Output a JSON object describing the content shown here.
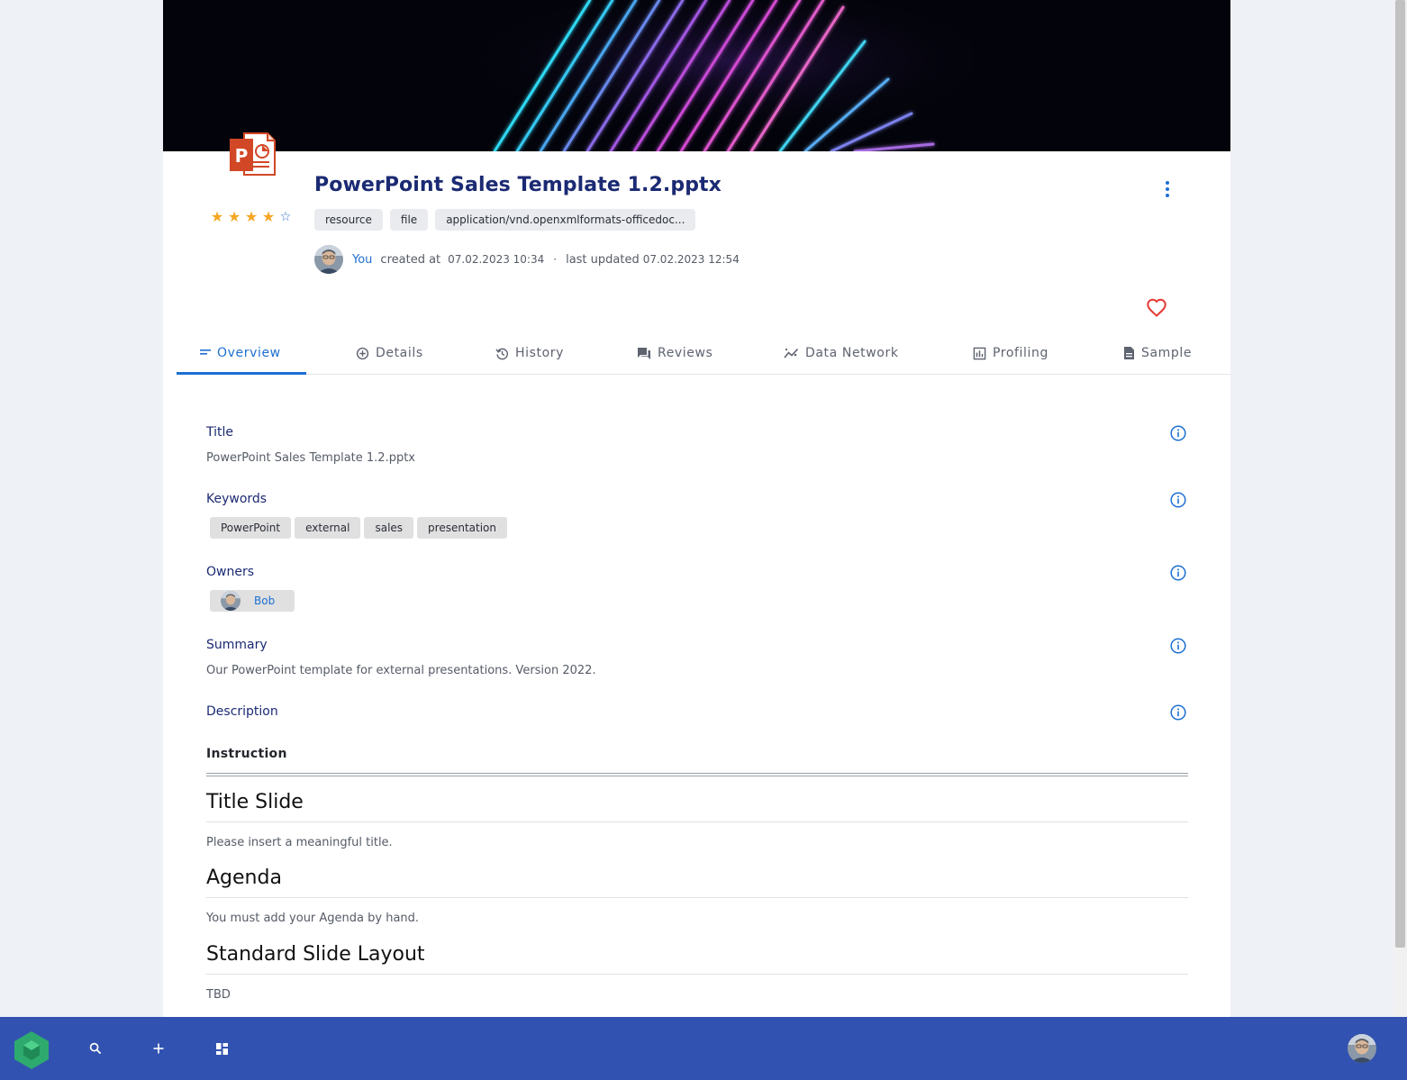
{
  "resource": {
    "title": "PowerPoint Sales Template 1.2.pptx",
    "rating": 4,
    "rating_max": 5,
    "type_tags": [
      "resource",
      "file",
      "application/vnd.openxmlformats-officedoc..."
    ],
    "icon": "powerpoint-file-icon",
    "meta": {
      "creator": "You",
      "created_label": "created at",
      "created_date": "07.02.2023 10:34",
      "separator": "·",
      "updated_label": "last updated",
      "updated_date": "07.02.2023 12:54"
    }
  },
  "tabs": {
    "overview": "Overview",
    "details": "Details",
    "history": "History",
    "reviews": "Reviews",
    "data_network": "Data Network",
    "profiling": "Profiling",
    "sample": "Sample"
  },
  "overview": {
    "title_label": "Title",
    "title_value": "PowerPoint Sales Template 1.2.pptx",
    "keywords_label": "Keywords",
    "keywords": [
      "PowerPoint",
      "external",
      "sales",
      "presentation"
    ],
    "owners_label": "Owners",
    "owners": [
      "Bob"
    ],
    "summary_label": "Summary",
    "summary_value": "Our PowerPoint template for external presentations. Version 2022.",
    "description_label": "Description"
  },
  "description_doc": {
    "heading": "Instruction",
    "sections": [
      {
        "title": "Title Slide",
        "text": "Please insert a meaningful title."
      },
      {
        "title": "Agenda",
        "text": "You must add your Agenda by hand."
      },
      {
        "title": "Standard Slide Layout",
        "text": "TBD"
      }
    ]
  },
  "colors": {
    "accent": "#1d6fd1",
    "title_navy": "#1b2a73",
    "bottom_bar": "#3152b0",
    "favorite_heart": "#e53935",
    "rating_star": "#f5a623",
    "logo_green": "#2eaa6e"
  },
  "icons": {
    "menu": "more-vert-icon",
    "favorite": "heart-outline-icon",
    "field_info": "info-circle-icon",
    "search": "search-icon",
    "add": "plus-icon",
    "dashboard": "dashboard-icon"
  }
}
